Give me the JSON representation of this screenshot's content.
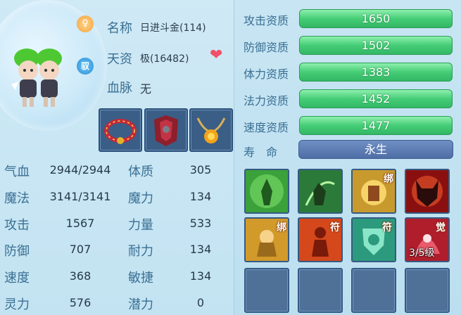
{
  "pet": {
    "name_label": "名称",
    "name_value": "日进斗金(114)",
    "talent_label": "天资",
    "talent_value": "极(16482)",
    "bloodline_label": "血脉",
    "bloodline_value": "无",
    "tame_badge": "驭"
  },
  "equipment": [
    {
      "name": "red-jeweled-collar"
    },
    {
      "name": "red-armor-piece"
    },
    {
      "name": "gold-pendant-necklace"
    }
  ],
  "stats": [
    {
      "label": "气血",
      "value": "2944/2944",
      "attr_label": "体质",
      "attr_value": "305"
    },
    {
      "label": "魔法",
      "value": "3141/3141",
      "attr_label": "魔力",
      "attr_value": "134"
    },
    {
      "label": "攻击",
      "value": "1567",
      "attr_label": "力量",
      "attr_value": "533"
    },
    {
      "label": "防御",
      "value": "707",
      "attr_label": "耐力",
      "attr_value": "134"
    },
    {
      "label": "速度",
      "value": "368",
      "attr_label": "敏捷",
      "attr_value": "134"
    },
    {
      "label": "灵力",
      "value": "576",
      "attr_label": "潜力",
      "attr_value": "0"
    }
  ],
  "aptitudes": [
    {
      "label": "攻击资质",
      "value": "1650"
    },
    {
      "label": "防御资质",
      "value": "1502"
    },
    {
      "label": "体力资质",
      "value": "1383"
    },
    {
      "label": "法力资质",
      "value": "1452"
    },
    {
      "label": "速度资质",
      "value": "1477"
    }
  ],
  "lifespan": {
    "label": "寿　命",
    "value": "永生"
  },
  "skills": [
    {
      "name": "green-aura-skill",
      "tag": "",
      "level": ""
    },
    {
      "name": "green-warrior-skill",
      "tag": "",
      "level": ""
    },
    {
      "name": "golden-fist-skill",
      "tag": "绑",
      "level": ""
    },
    {
      "name": "demon-skill",
      "tag": "",
      "level": ""
    },
    {
      "name": "golden-monk-skill",
      "tag": "绑",
      "level": ""
    },
    {
      "name": "red-figure-skill",
      "tag": "符",
      "level": ""
    },
    {
      "name": "green-shield-skill",
      "tag": "符",
      "level": ""
    },
    {
      "name": "awakened-skill",
      "tag": "觉",
      "level": "3/5级"
    }
  ],
  "colors": {
    "label_blue": "#3a6f93",
    "aptitude_green": "#45cd76",
    "lifespan_blue": "#4f6ea6",
    "slot_blue": "#456a93",
    "heart_red": "#f0506a"
  }
}
